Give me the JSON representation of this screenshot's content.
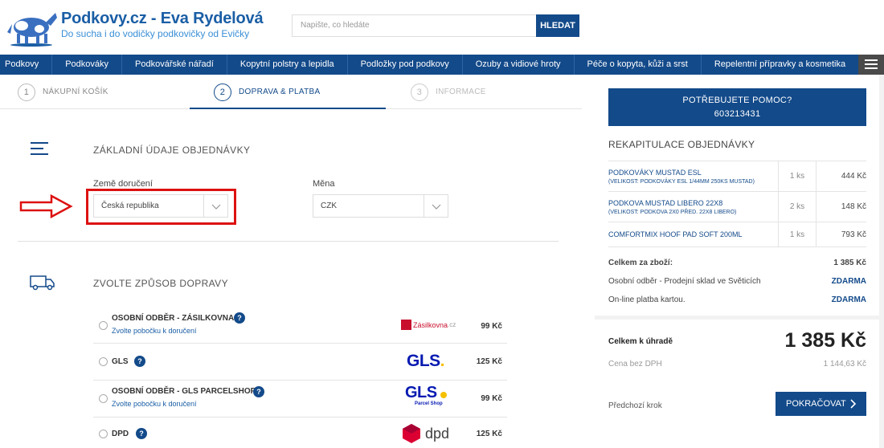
{
  "header": {
    "site_title": "Podkovy.cz - Eva Rydelová",
    "site_subtitle": "Do sucha i do vodičky podkovičky od Evičky",
    "search_placeholder": "Napište, co hledáte",
    "search_button": "HLEDAT"
  },
  "nav": {
    "items": [
      "Podkovy",
      "Podkováky",
      "Podkovářské nářadí",
      "Kopytní polstry a lepidla",
      "Podložky pod podkovy",
      "Ozuby a vidiové hroty",
      "Péče o kopyta, kůži a srst",
      "Repelentní přípravky a kosmetika"
    ]
  },
  "steps": [
    {
      "num": "1",
      "label": "NÁKUPNÍ KOŠÍK"
    },
    {
      "num": "2",
      "label": "DOPRAVA & PLATBA"
    },
    {
      "num": "3",
      "label": "INFORMACE"
    }
  ],
  "order": {
    "section_title": "ZÁKLADNÍ ÚDAJE OBJEDNÁVKY",
    "country_label": "Země doručení",
    "country_value": "Česká republika",
    "currency_label": "Měna",
    "currency_value": "CZK"
  },
  "shipping": {
    "section_title": "ZVOLTE ZPŮSOB DOPRAVY",
    "pick_branch": "Zvolte pobočku k doručení",
    "options": [
      {
        "name": "OSOBNÍ ODBĚR - ZÁSILKOVNA",
        "price": "99 Kč",
        "logo": "Zásilkovna"
      },
      {
        "name": "GLS",
        "price": "125 Kč",
        "logo": "GLS"
      },
      {
        "name": "OSOBNÍ ODBĚR - GLS PARCELSHOP",
        "price": "99 Kč",
        "logo": "GLS",
        "logo_sub": "Parcel Shop"
      },
      {
        "name": "DPD",
        "price": "125 Kč",
        "logo": "dpd"
      }
    ]
  },
  "sidebar": {
    "help_line1": "POTŘEBUJETE POMOC?",
    "help_line2": "603213431",
    "recap_title": "REKAPITULACE OBJEDNÁVKY",
    "items": [
      {
        "name": "PODKOVÁKY MUSTAD ESL",
        "variant": "(VELIKOST: PODKOVÁKY ESL 1/44MM 250KS MUSTAD)",
        "qty": "1 ks",
        "price": "444 Kč"
      },
      {
        "name": "PODKOVA MUSTAD LIBERO 22X8",
        "variant": "(VELIKOST: PODKOVA 2X0 PŘED. 22X8 LIBERO)",
        "qty": "2 ks",
        "price": "148 Kč"
      },
      {
        "name": "COMFORTMIX HOOF PAD SOFT 200ML",
        "variant": "",
        "qty": "1 ks",
        "price": "793 Kč"
      }
    ],
    "goods_total_label": "Celkem za zboží:",
    "goods_total_value": "1 385 Kč",
    "pickup_label": "Osobní odběr - Prodejní sklad ve Světicích",
    "pickup_value": "ZDARMA",
    "payment_label": "On-line platba kartou.",
    "payment_value": "ZDARMA",
    "total_label": "Celkem k úhradě",
    "total_value": "1 385 Kč",
    "net_label": "Cena bez DPH",
    "net_value": "1 144,63 Kč",
    "prev_step": "Předchozí krok",
    "continue": "POKRAČOVAT"
  }
}
